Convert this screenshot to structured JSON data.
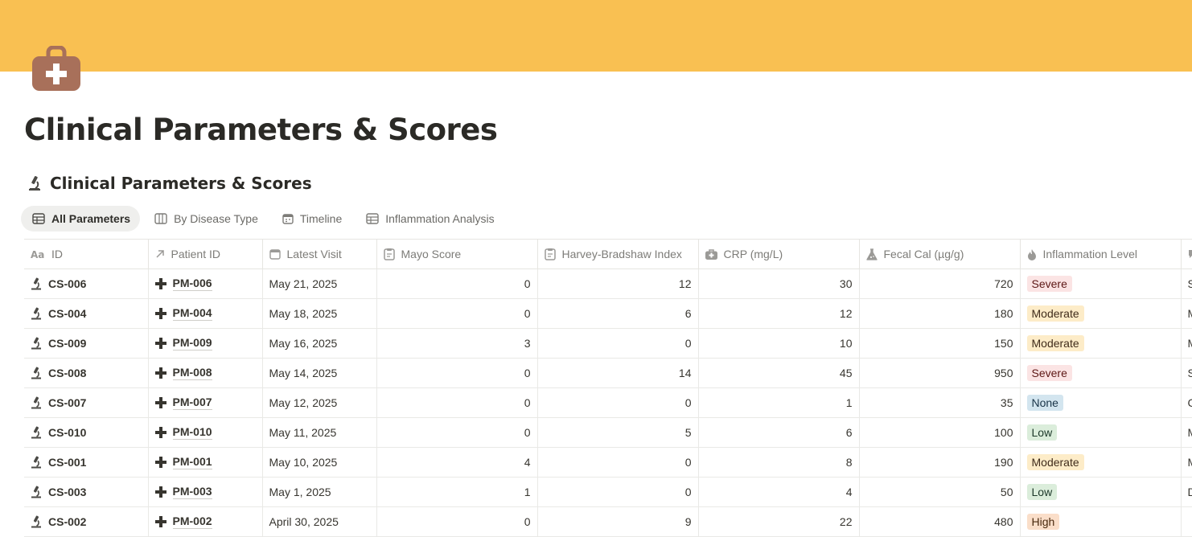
{
  "colors": {
    "cover": "#f9c052",
    "icon": "#a8705a"
  },
  "page": {
    "title": "Clinical Parameters & Scores",
    "icon": "medical-bag-icon"
  },
  "database": {
    "title": "Clinical Parameters & Scores",
    "icon": "microscope-icon"
  },
  "views": [
    {
      "label": "All Parameters",
      "icon": "table-icon",
      "active": true
    },
    {
      "label": "By Disease Type",
      "icon": "board-icon",
      "active": false
    },
    {
      "label": "Timeline",
      "icon": "calendar-icon",
      "active": false
    },
    {
      "label": "Inflammation Analysis",
      "icon": "table-icon",
      "active": false
    }
  ],
  "columns": [
    {
      "label": "ID",
      "icon": "title-icon"
    },
    {
      "label": "Patient ID",
      "icon": "relation-arrow-icon"
    },
    {
      "label": "Latest Visit",
      "icon": "calendar-icon"
    },
    {
      "label": "Mayo Score",
      "icon": "clipboard-icon"
    },
    {
      "label": "Harvey-Bradshaw Index",
      "icon": "clipboard-icon"
    },
    {
      "label": "CRP (mg/L)",
      "icon": "medical-bag-icon"
    },
    {
      "label": "Fecal Cal (µg/g)",
      "icon": "flask-icon"
    },
    {
      "label": "Inflammation Level",
      "icon": "fire-icon"
    }
  ],
  "rows": [
    {
      "id": "CS-006",
      "patient": "PM-006",
      "visit": "May 21, 2025",
      "mayo": "0",
      "hbi": "12",
      "crp": "30",
      "fecal": "720",
      "level": "Severe",
      "level_class": "severe",
      "extra": "S"
    },
    {
      "id": "CS-004",
      "patient": "PM-004",
      "visit": "May 18, 2025",
      "mayo": "0",
      "hbi": "6",
      "crp": "12",
      "fecal": "180",
      "level": "Moderate",
      "level_class": "moderate",
      "extra": "M"
    },
    {
      "id": "CS-009",
      "patient": "PM-009",
      "visit": "May 16, 2025",
      "mayo": "3",
      "hbi": "0",
      "crp": "10",
      "fecal": "150",
      "level": "Moderate",
      "level_class": "moderate",
      "extra": "M"
    },
    {
      "id": "CS-008",
      "patient": "PM-008",
      "visit": "May 14, 2025",
      "mayo": "0",
      "hbi": "14",
      "crp": "45",
      "fecal": "950",
      "level": "Severe",
      "level_class": "severe",
      "extra": "S"
    },
    {
      "id": "CS-007",
      "patient": "PM-007",
      "visit": "May 12, 2025",
      "mayo": "0",
      "hbi": "0",
      "crp": "1",
      "fecal": "35",
      "level": "None",
      "level_class": "none",
      "extra": "C"
    },
    {
      "id": "CS-010",
      "patient": "PM-010",
      "visit": "May 11, 2025",
      "mayo": "0",
      "hbi": "5",
      "crp": "6",
      "fecal": "100",
      "level": "Low",
      "level_class": "low",
      "extra": "M"
    },
    {
      "id": "CS-001",
      "patient": "PM-001",
      "visit": "May 10, 2025",
      "mayo": "4",
      "hbi": "0",
      "crp": "8",
      "fecal": "190",
      "level": "Moderate",
      "level_class": "moderate",
      "extra": "M"
    },
    {
      "id": "CS-003",
      "patient": "PM-003",
      "visit": "May 1, 2025",
      "mayo": "1",
      "hbi": "0",
      "crp": "4",
      "fecal": "50",
      "level": "Low",
      "level_class": "low",
      "extra": "D"
    },
    {
      "id": "CS-002",
      "patient": "PM-002",
      "visit": "April 30, 2025",
      "mayo": "0",
      "hbi": "9",
      "crp": "22",
      "fecal": "480",
      "level": "High",
      "level_class": "high",
      "extra": ""
    }
  ]
}
